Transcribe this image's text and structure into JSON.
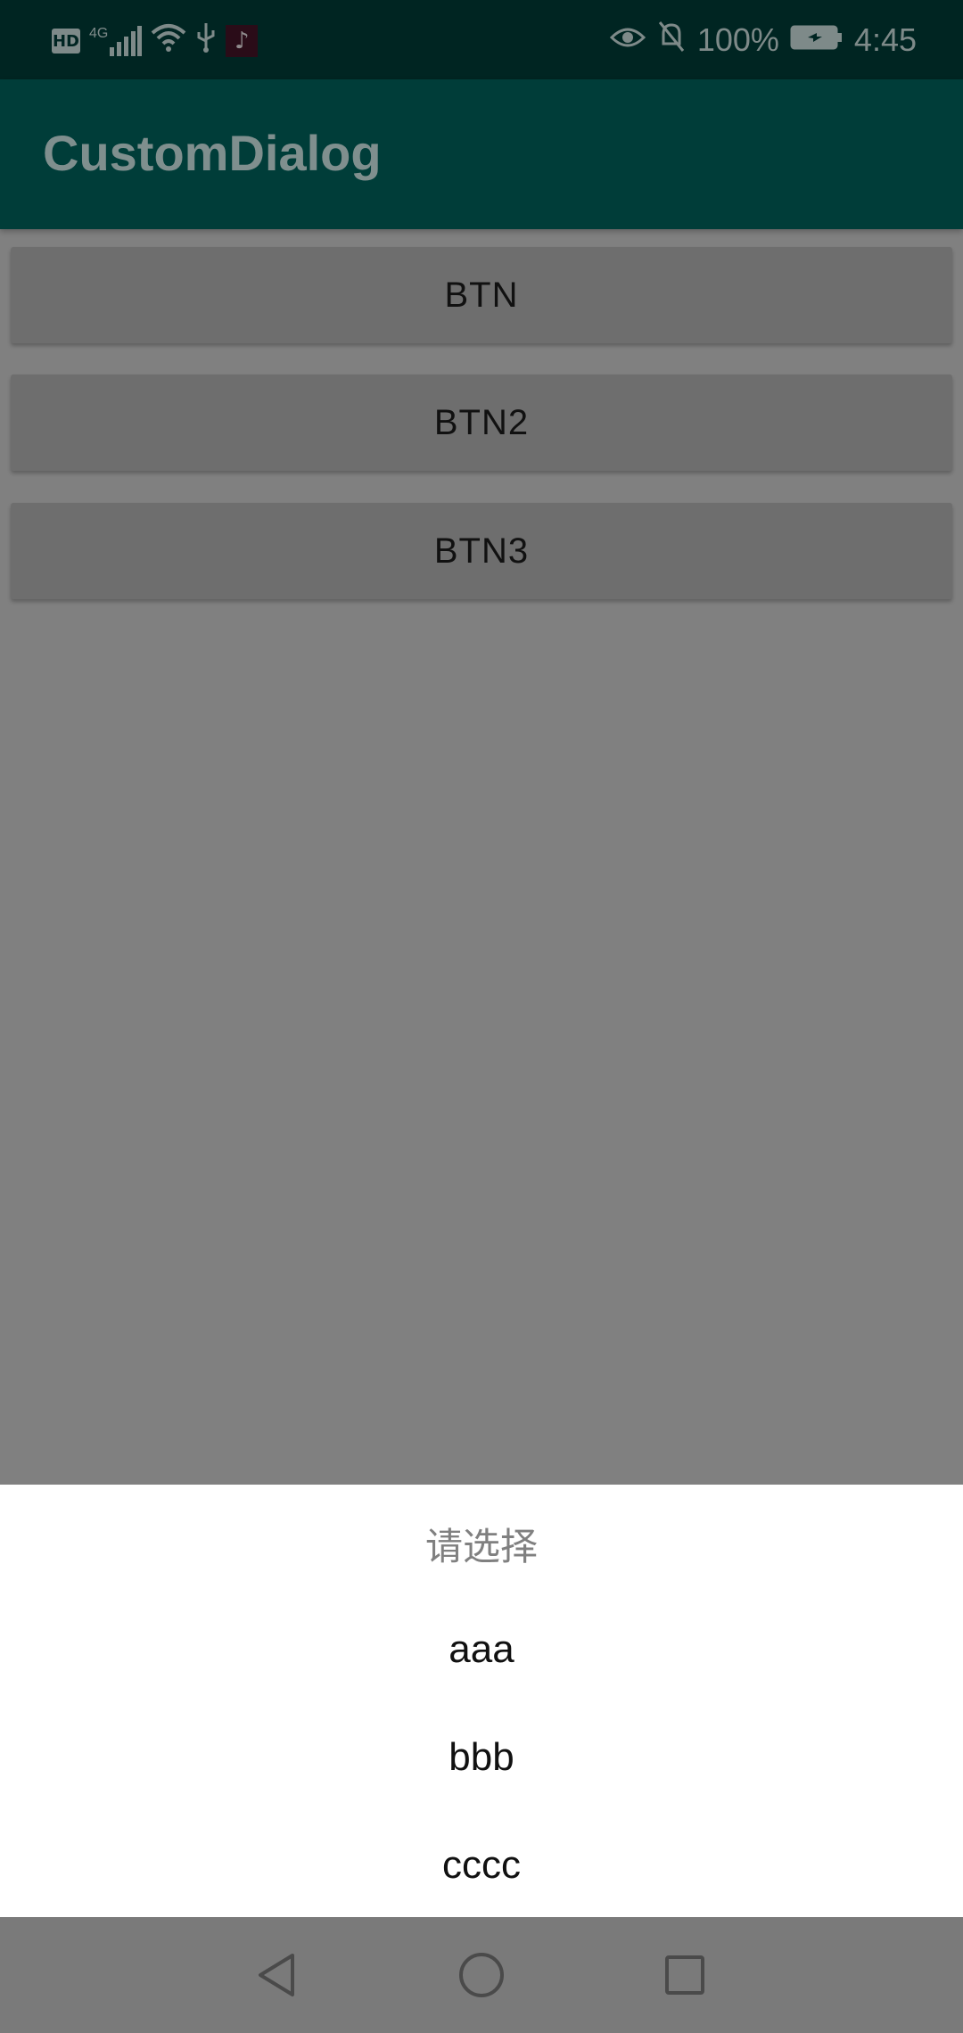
{
  "status_bar": {
    "hd_label": "HD",
    "network_label": "4G",
    "battery_percent": "100%",
    "time": "4:45"
  },
  "app_bar": {
    "title": "CustomDialog"
  },
  "buttons": [
    {
      "label": "BTN"
    },
    {
      "label": "BTN2"
    },
    {
      "label": "BTN3"
    }
  ],
  "dialog": {
    "title": "请选择",
    "items": [
      {
        "label": "aaa"
      },
      {
        "label": "bbb"
      },
      {
        "label": "cccc"
      }
    ]
  },
  "nav_bar": {
    "icons": [
      "back-icon",
      "home-icon",
      "recent-apps-icon"
    ]
  },
  "colors": {
    "status_bar": "#002522",
    "app_bar": "#003d39",
    "scrim": "#808080",
    "dialog_bg": "#ffffff"
  }
}
